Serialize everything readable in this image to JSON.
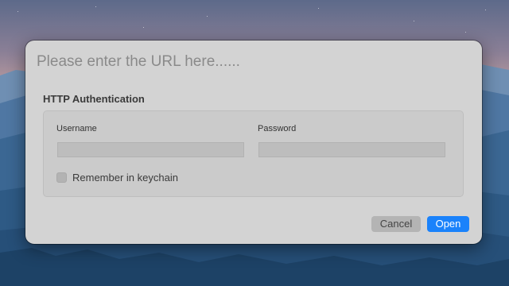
{
  "dialog": {
    "url_placeholder": "Please enter the URL here......",
    "section_title": "HTTP Authentication",
    "username_label": "Username",
    "password_label": "Password",
    "username_value": "",
    "password_value": "",
    "remember_label": "Remember in keychain",
    "remember_checked": false,
    "cancel_label": "Cancel",
    "open_label": "Open"
  },
  "colors": {
    "accent": "#1a82fb",
    "dialog_background": "#d3d3d3"
  }
}
